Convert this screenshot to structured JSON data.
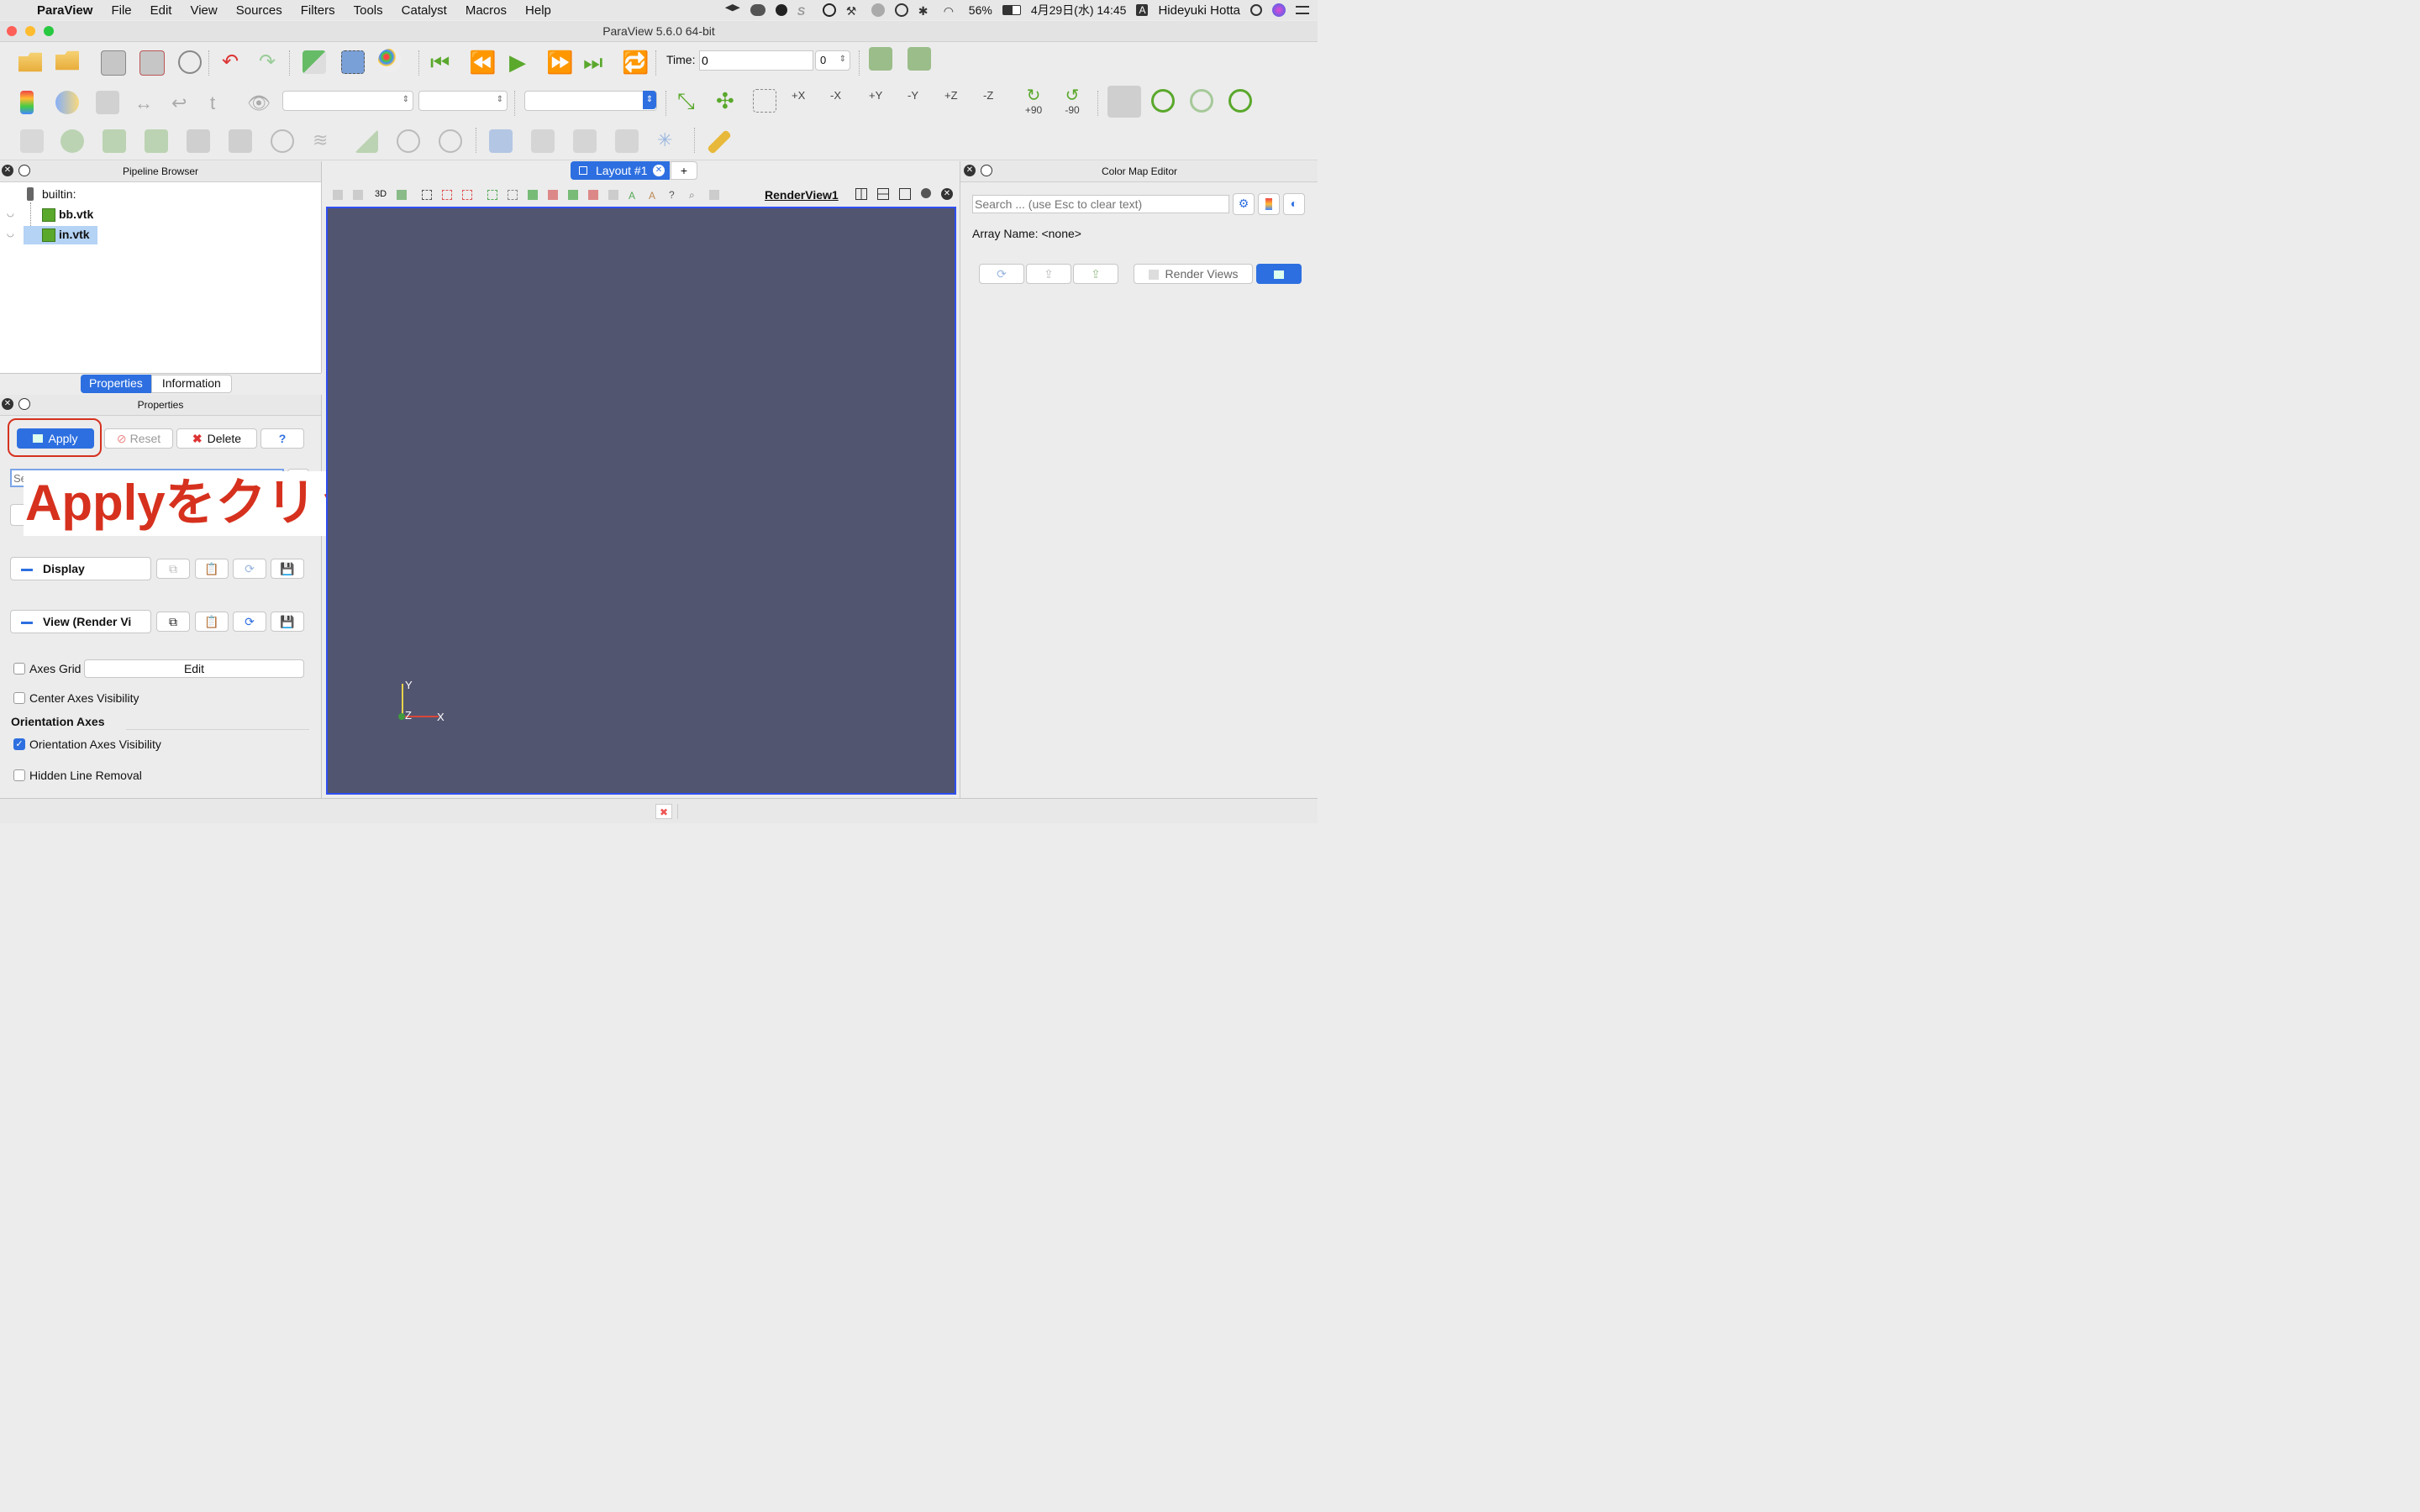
{
  "menubar": {
    "apple": "",
    "app_name": "ParaView",
    "items": [
      "File",
      "Edit",
      "View",
      "Sources",
      "Filters",
      "Tools",
      "Catalyst",
      "Macros",
      "Help"
    ],
    "battery": "56%",
    "datetime": "4月29日(水) 14:45",
    "input_mode": "A",
    "user": "Hideyuki Hotta"
  },
  "window": {
    "title": "ParaView 5.6.0 64-bit"
  },
  "toolbar": {
    "time_label": "Time:",
    "time_value": "0",
    "time_index": "0",
    "camera_labels": [
      "+X",
      "-X",
      "+Y",
      "-Y",
      "+Z",
      "-Z",
      "+90",
      "-90"
    ]
  },
  "pipeline": {
    "title": "Pipeline Browser",
    "root": "builtin:",
    "items": [
      "bb.vtk",
      "in.vtk"
    ]
  },
  "props_tabs": {
    "properties": "Properties",
    "information": "Information"
  },
  "properties": {
    "title": "Properties",
    "apply": "Apply",
    "reset": "Reset",
    "delete": "Delete",
    "help": "?",
    "search_placeholder": "Se",
    "display_section": "Display",
    "view_section": "View (Render Vi",
    "axes_grid": "Axes Grid",
    "edit": "Edit",
    "center_axes": "Center Axes Visibility",
    "orientation_header": "Orientation Axes",
    "orientation_vis": "Orientation Axes Visibility",
    "hidden_line": "Hidden Line Removal"
  },
  "annotation": {
    "text": "Applyをクリック"
  },
  "layout": {
    "tab": "Layout #1",
    "add": "+",
    "view_toolbar_3d": "3D",
    "view_name": "RenderView1",
    "axes": {
      "y": "Y",
      "z": "Z",
      "x": "X"
    }
  },
  "colormap": {
    "title": "Color Map Editor",
    "search_placeholder": "Search ... (use Esc to clear text)",
    "array_name": "Array Name: <none>",
    "render_views": "Render Views"
  },
  "colors": {
    "render_bg": "#525570",
    "selection": "#b4d3f5",
    "apply_blue": "#2d6fe0",
    "annotation_red": "#d6311e"
  }
}
